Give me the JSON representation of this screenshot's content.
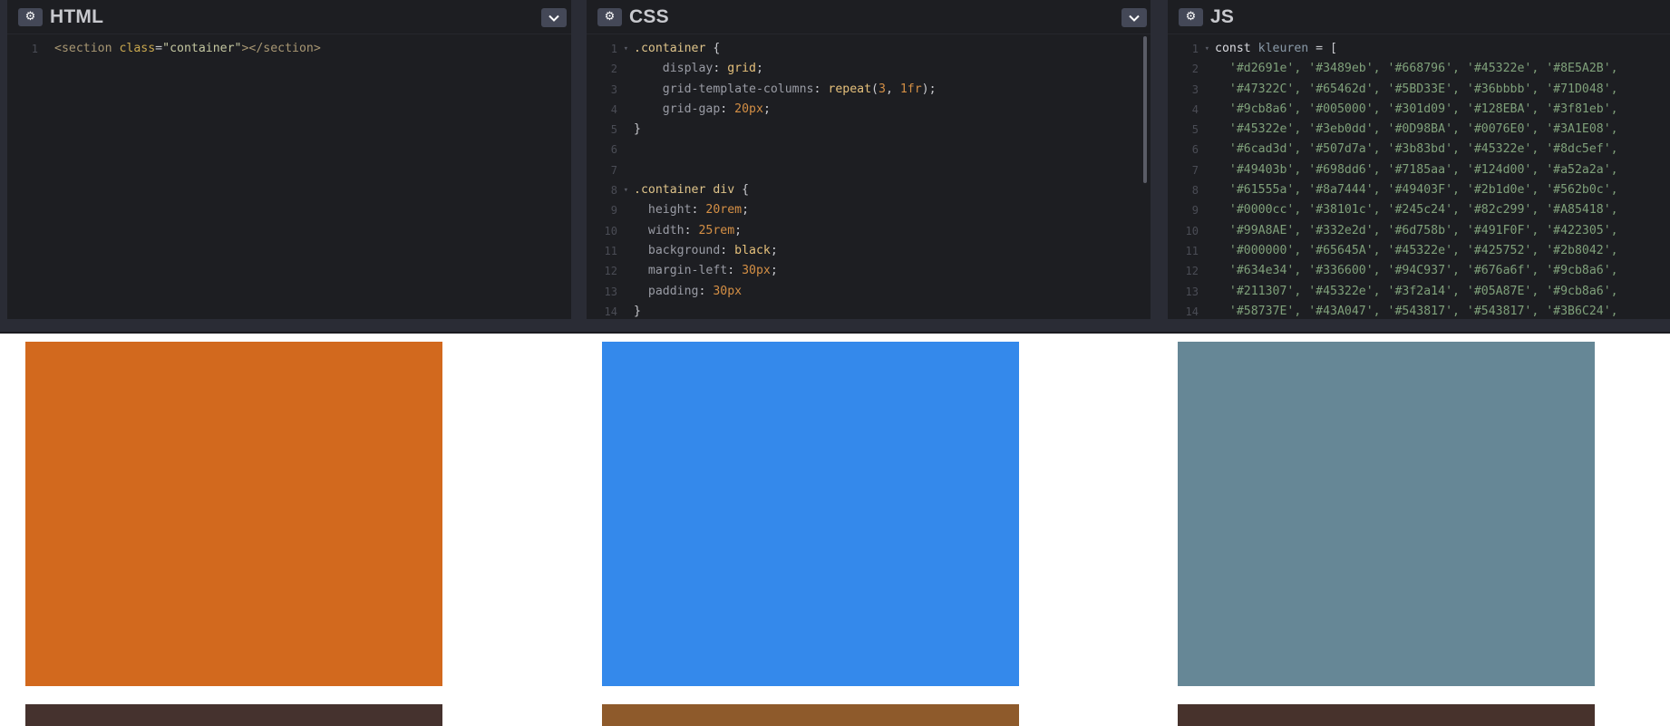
{
  "panels": {
    "html": {
      "title": "HTML"
    },
    "css": {
      "title": "CSS"
    },
    "js": {
      "title": "JS"
    }
  },
  "html_code": [
    {
      "n": "1",
      "parts": [
        {
          "c": "c-tag",
          "t": "<section "
        },
        {
          "c": "c-attr",
          "t": "class"
        },
        {
          "c": "c-punc",
          "t": "="
        },
        {
          "c": "c-str",
          "t": "\"container\""
        },
        {
          "c": "c-tag",
          "t": "></section>"
        }
      ]
    }
  ],
  "css_code": [
    {
      "n": "1",
      "fold": true,
      "parts": [
        {
          "c": "c-sel",
          "t": ".container"
        },
        {
          "c": "c-punc",
          "t": " {"
        }
      ]
    },
    {
      "n": "2",
      "parts": [
        {
          "c": "c-prop",
          "t": "    display"
        },
        {
          "c": "c-punc",
          "t": ": "
        },
        {
          "c": "c-val",
          "t": "grid"
        },
        {
          "c": "c-punc",
          "t": ";"
        }
      ]
    },
    {
      "n": "3",
      "parts": [
        {
          "c": "c-prop",
          "t": "    grid-template-columns"
        },
        {
          "c": "c-punc",
          "t": ": "
        },
        {
          "c": "c-val",
          "t": "repeat"
        },
        {
          "c": "c-punc",
          "t": "("
        },
        {
          "c": "c-num",
          "t": "3"
        },
        {
          "c": "c-punc",
          "t": ", "
        },
        {
          "c": "c-num",
          "t": "1fr"
        },
        {
          "c": "c-punc",
          "t": ");"
        }
      ]
    },
    {
      "n": "4",
      "parts": [
        {
          "c": "c-prop",
          "t": "    grid-gap"
        },
        {
          "c": "c-punc",
          "t": ": "
        },
        {
          "c": "c-num",
          "t": "20px"
        },
        {
          "c": "c-punc",
          "t": ";"
        }
      ]
    },
    {
      "n": "5",
      "parts": [
        {
          "c": "c-punc",
          "t": "}"
        }
      ]
    },
    {
      "n": "6",
      "parts": []
    },
    {
      "n": "7",
      "parts": []
    },
    {
      "n": "8",
      "fold": true,
      "parts": [
        {
          "c": "c-sel",
          "t": ".container div"
        },
        {
          "c": "c-punc",
          "t": " {"
        }
      ]
    },
    {
      "n": "9",
      "parts": [
        {
          "c": "c-prop",
          "t": "  height"
        },
        {
          "c": "c-punc",
          "t": ": "
        },
        {
          "c": "c-num",
          "t": "20rem"
        },
        {
          "c": "c-punc",
          "t": ";"
        }
      ]
    },
    {
      "n": "10",
      "parts": [
        {
          "c": "c-prop",
          "t": "  width"
        },
        {
          "c": "c-punc",
          "t": ": "
        },
        {
          "c": "c-num",
          "t": "25rem"
        },
        {
          "c": "c-punc",
          "t": ";"
        }
      ]
    },
    {
      "n": "11",
      "parts": [
        {
          "c": "c-prop",
          "t": "  background"
        },
        {
          "c": "c-punc",
          "t": ": "
        },
        {
          "c": "c-val",
          "t": "black"
        },
        {
          "c": "c-punc",
          "t": ";"
        }
      ]
    },
    {
      "n": "12",
      "parts": [
        {
          "c": "c-prop",
          "t": "  margin-left"
        },
        {
          "c": "c-punc",
          "t": ": "
        },
        {
          "c": "c-num",
          "t": "30px"
        },
        {
          "c": "c-punc",
          "t": ";"
        }
      ]
    },
    {
      "n": "13",
      "parts": [
        {
          "c": "c-prop",
          "t": "  padding"
        },
        {
          "c": "c-punc",
          "t": ": "
        },
        {
          "c": "c-num",
          "t": "30px"
        }
      ]
    },
    {
      "n": "14",
      "parts": [
        {
          "c": "c-punc",
          "t": "}"
        }
      ]
    }
  ],
  "js_code": [
    {
      "n": "1",
      "fold": true,
      "parts": [
        {
          "c": "c-kw",
          "t": "const "
        },
        {
          "c": "c-var",
          "t": "kleuren"
        },
        {
          "c": "c-punc",
          "t": " = ["
        }
      ]
    },
    {
      "n": "2",
      "parts": [
        {
          "c": "c-jsstr",
          "t": "  '#d2691e', '#3489eb', '#668796', '#45322e', '#8E5A2B',"
        }
      ]
    },
    {
      "n": "3",
      "parts": [
        {
          "c": "c-jsstr",
          "t": "  '#47322C', '#65462d', '#5BD33E', '#36bbbb', '#71D048',"
        }
      ]
    },
    {
      "n": "4",
      "parts": [
        {
          "c": "c-jsstr",
          "t": "  '#9cb8a6', '#005000', '#301d09', '#128EBA', '#3f81eb',"
        }
      ]
    },
    {
      "n": "5",
      "parts": [
        {
          "c": "c-jsstr",
          "t": "  '#45322e', '#3eb0dd', '#0D98BA', '#0076E0', '#3A1E08',"
        }
      ]
    },
    {
      "n": "6",
      "parts": [
        {
          "c": "c-jsstr",
          "t": "  '#6cad3d', '#507d7a', '#3b83bd', '#45322e', '#8dc5ef',"
        }
      ]
    },
    {
      "n": "7",
      "parts": [
        {
          "c": "c-jsstr",
          "t": "  '#49403b', '#698dd6', '#7185aa', '#124d00', '#a52a2a',"
        }
      ]
    },
    {
      "n": "8",
      "parts": [
        {
          "c": "c-jsstr",
          "t": "  '#61555a', '#8a7444', '#49403F', '#2b1d0e', '#562b0c',"
        }
      ]
    },
    {
      "n": "9",
      "parts": [
        {
          "c": "c-jsstr",
          "t": "  '#0000cc', '#38101c', '#245c24', '#82c299', '#A85418',"
        }
      ]
    },
    {
      "n": "10",
      "parts": [
        {
          "c": "c-jsstr",
          "t": "  '#99A8AE', '#332e2d', '#6d758b', '#491F0F', '#422305',"
        }
      ]
    },
    {
      "n": "11",
      "parts": [
        {
          "c": "c-jsstr",
          "t": "  '#000000', '#65645A', '#45322e', '#425752', '#2b8042',"
        }
      ]
    },
    {
      "n": "12",
      "parts": [
        {
          "c": "c-jsstr",
          "t": "  '#634e34', '#336600', '#94C937', '#676a6f', '#9cb8a6',"
        }
      ]
    },
    {
      "n": "13",
      "parts": [
        {
          "c": "c-jsstr",
          "t": "  '#211307', '#45322e', '#3f2a14', '#05A87E', '#9cb8a6',"
        }
      ]
    },
    {
      "n": "14",
      "parts": [
        {
          "c": "c-jsstr",
          "t": "  '#58737E', '#43A047', '#543817', '#543817', '#3B6C24',"
        }
      ]
    }
  ],
  "swatches": [
    {
      "color": "#d2691e"
    },
    {
      "color": "#3489eb"
    },
    {
      "color": "#668796"
    },
    {
      "color": "#45322e"
    },
    {
      "color": "#8E5A2B"
    },
    {
      "color": "#47322C"
    }
  ],
  "colors": {
    "editor_bg": "#1d1e22",
    "frame_bg": "#2a2c35",
    "button_bg": "#444857"
  }
}
